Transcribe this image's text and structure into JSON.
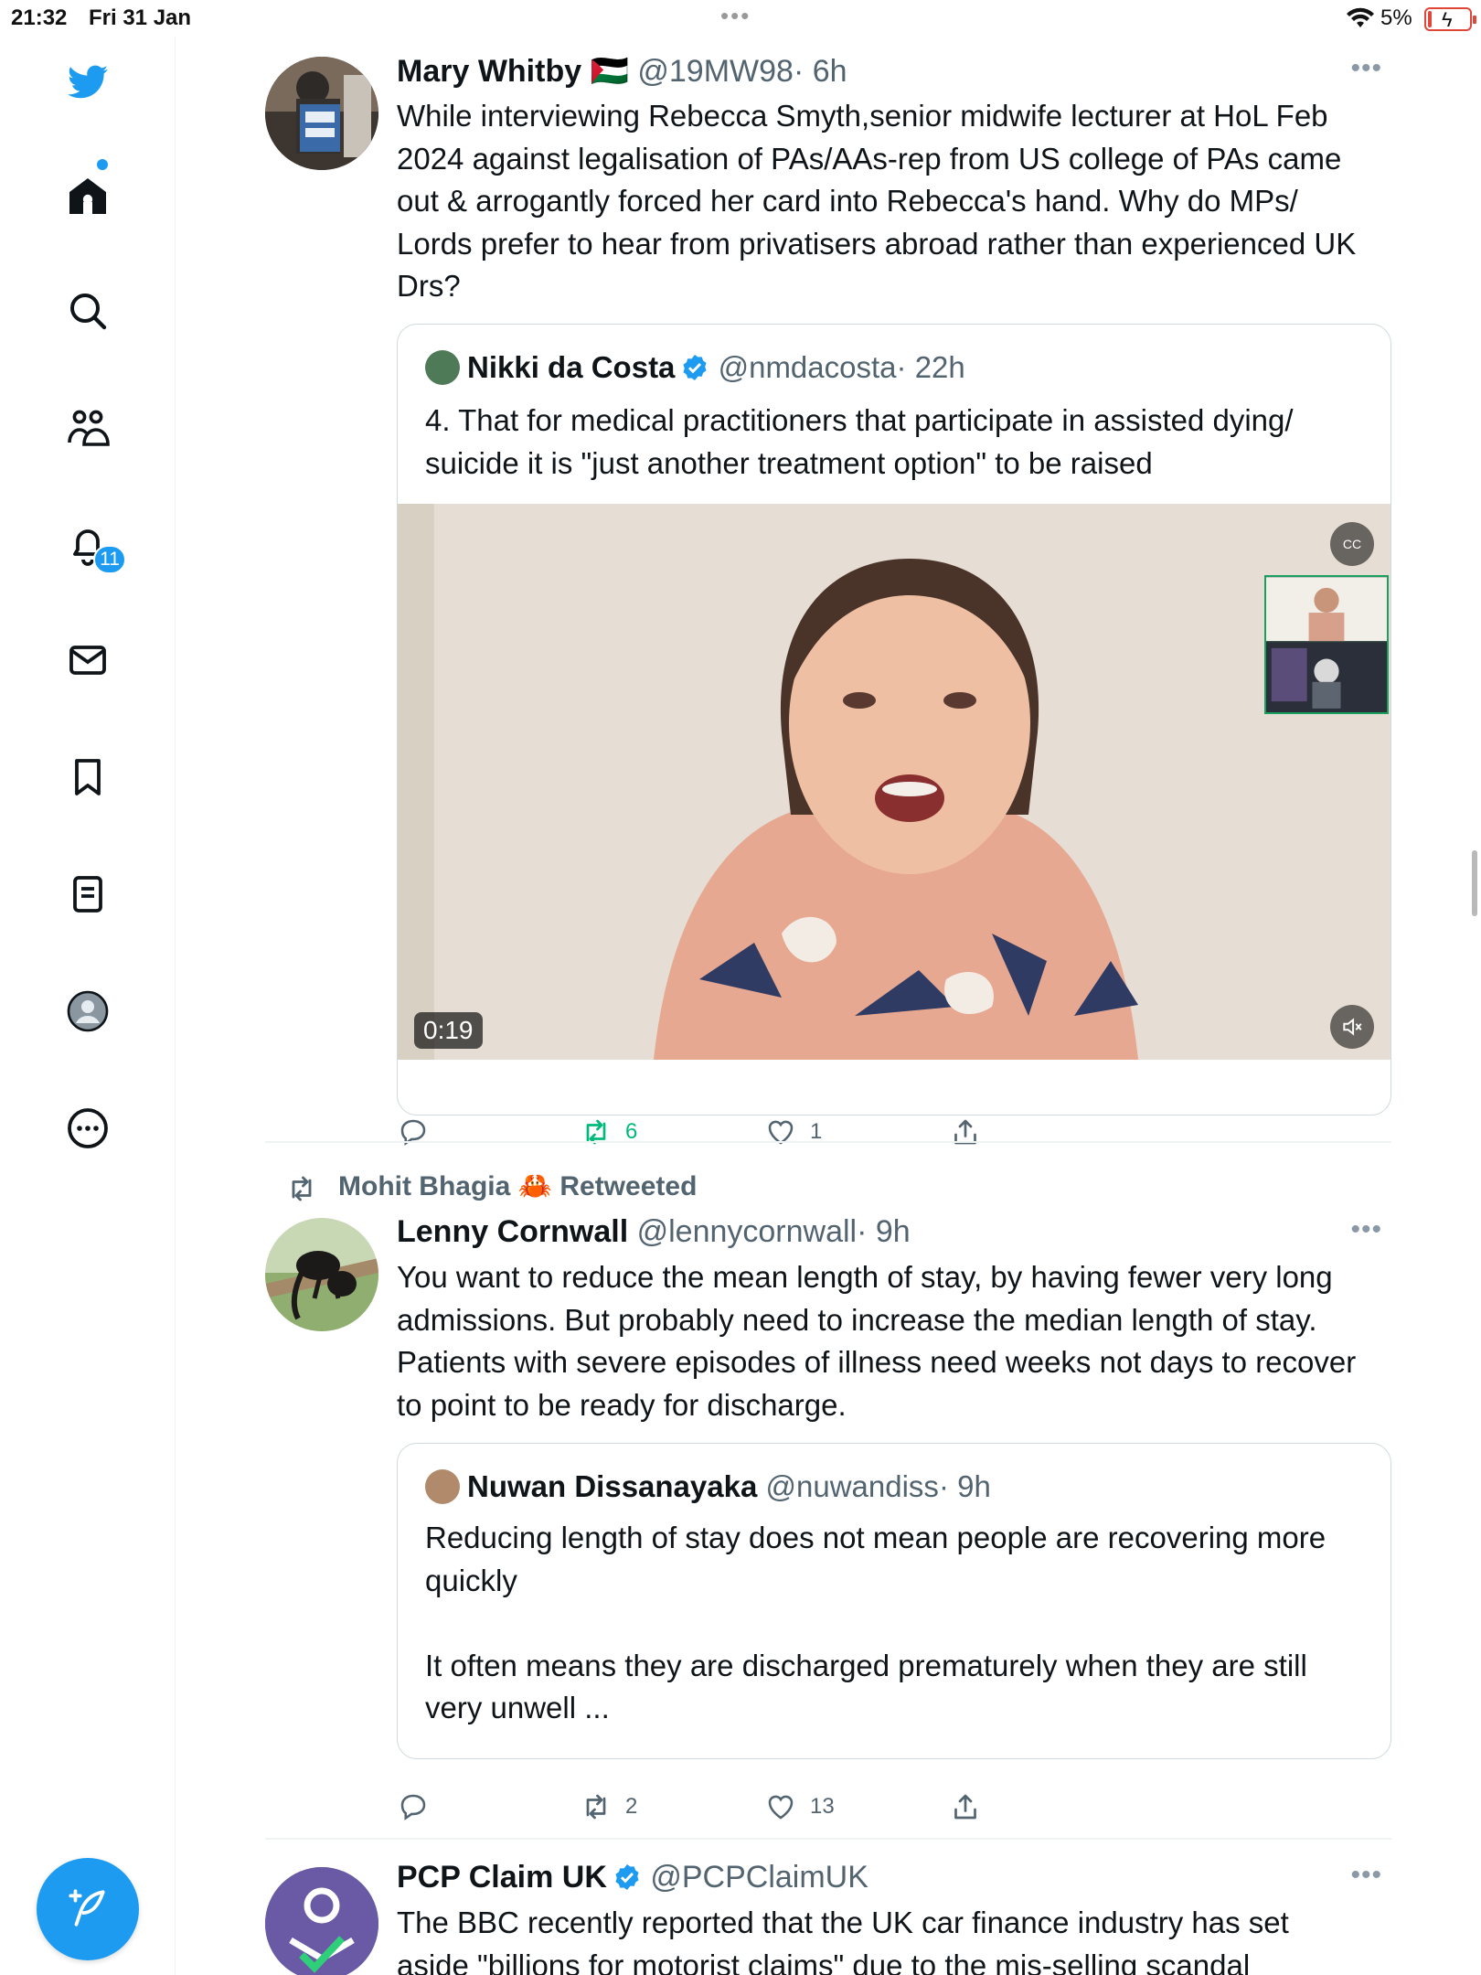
{
  "status_bar": {
    "time": "21:32",
    "date": "Fri 31 Jan",
    "battery_percent": "5%"
  },
  "sidebar": {
    "items": [
      {
        "icon": "twitter-logo-icon"
      },
      {
        "icon": "home-icon"
      },
      {
        "icon": "search-icon"
      },
      {
        "icon": "communities-icon"
      },
      {
        "icon": "notifications-icon"
      },
      {
        "icon": "messages-icon"
      },
      {
        "icon": "bookmarks-icon"
      },
      {
        "icon": "lists-icon"
      },
      {
        "icon": "profile-icon"
      },
      {
        "icon": "more-icon"
      }
    ],
    "notifications_badge": "11",
    "compose_icon": "compose-tweet-icon",
    "accent_color": "#1d9bf0"
  },
  "timeline": {
    "tweets": [
      {
        "name": "Mary Whitby",
        "flag": "🇵🇸",
        "handle": "@19MW98",
        "time": "· 6h",
        "text_lines": [
          "While interviewing Rebecca Smyth,senior midwife lecturer at HoL Feb",
          "2024 against legalisation of PAs/AAs-rep from US college of PAs came",
          "out & arrogantly forced her card into Rebecca's hand. Why do MPs/",
          "Lords prefer to hear from privatisers abroad rather than experienced UK",
          "Drs?"
        ],
        "quote": {
          "name": "Nikki da Costa",
          "handle": "@nmdacosta",
          "time": "· 22h",
          "text_lines": [
            "4. That for medical practitioners that participate in assisted dying/",
            "suicide it is \"just another treatment option\" to be raised"
          ],
          "video_duration": "0:19"
        },
        "actions": {
          "replies": "",
          "retweets": "6",
          "likes": "1"
        }
      },
      {
        "retweeted_by": "Mohit Bhagia 🦀 Retweeted",
        "name": "Lenny Cornwall",
        "handle": "@lennycornwall",
        "time": "· 9h",
        "text_lines": [
          "You want to reduce the mean length of stay, by having fewer very long",
          "admissions. But probably need to increase the median length of stay.",
          "Patients with severe episodes of illness need weeks not days to recover",
          "to point to be ready for discharge."
        ],
        "quote": {
          "name": "Nuwan Dissanayaka",
          "handle": "@nuwandiss",
          "time": "· 9h",
          "text_lines": [
            "Reducing length of stay does not mean people are recovering more",
            "quickly",
            "",
            "It often means they are discharged prematurely when they are still",
            "very unwell ..."
          ]
        },
        "actions": {
          "replies": "",
          "retweets": "2",
          "likes": "13"
        }
      },
      {
        "name": "PCP Claim UK",
        "handle": "@PCPClaimUK",
        "time": "",
        "text_lines": [
          "The BBC recently reported that the UK car finance industry has set",
          "aside \"billions for motorist claims\" due to the mis-selling scandal"
        ]
      }
    ]
  }
}
